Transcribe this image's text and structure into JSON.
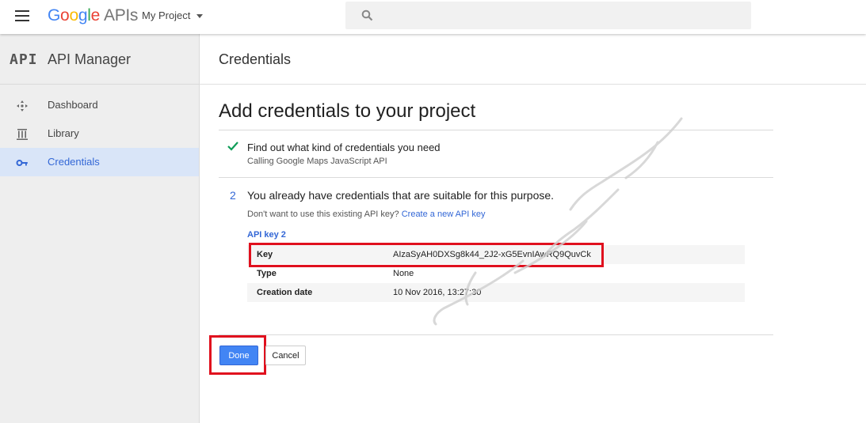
{
  "header": {
    "logo_parts": [
      "G",
      "o",
      "o",
      "g",
      "l",
      "e"
    ],
    "logo_suffix": "APIs",
    "project": "My Project",
    "search_placeholder": ""
  },
  "sidebar": {
    "logo": "API",
    "title": "API Manager",
    "items": [
      {
        "label": "Dashboard",
        "icon": "dashboard-icon"
      },
      {
        "label": "Library",
        "icon": "library-icon"
      },
      {
        "label": "Credentials",
        "icon": "key-icon",
        "active": true
      }
    ]
  },
  "main": {
    "page_title": "Credentials",
    "heading": "Add credentials to your project",
    "step1": {
      "title": "Find out what kind of credentials you need",
      "subtitle": "Calling Google Maps JavaScript API"
    },
    "step2": {
      "number": "2",
      "title": "You already have credentials that are suitable for this purpose.",
      "hint": "Don't want to use this existing API key?",
      "hint_link": "Create a new API key",
      "key_name": "API key 2",
      "rows": [
        {
          "label": "Key",
          "value": "AIzaSyAH0DXSg8k44_2J2-xG5EvnIAwRQ9QuvCk"
        },
        {
          "label": "Type",
          "value": "None"
        },
        {
          "label": "Creation date",
          "value": "10 Nov 2016, 13:27:30"
        }
      ]
    },
    "done_label": "Done",
    "cancel_label": "Cancel"
  },
  "colors": {
    "accent": "#3367d6",
    "highlight": "#e0101e",
    "active_nav_bg": "#d9e5f8"
  }
}
